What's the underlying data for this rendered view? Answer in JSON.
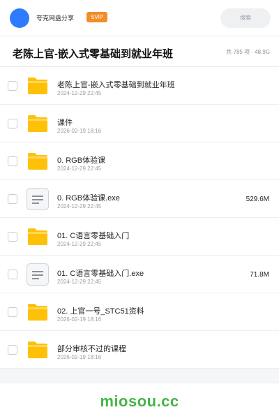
{
  "header": {
    "site_name": "夸克网盘分享",
    "badge": "SVIP",
    "search_placeholder": "搜索",
    "accent_color": "#2f7bff",
    "badge_color": "#f28c28"
  },
  "share": {
    "title": "老陈上官-嵌入式零基础到就业年班",
    "summary": "共 785 项 · 48.9G"
  },
  "items": [
    {
      "type": "folder-icon",
      "name": "老陈上官-嵌入式零基础到就业年班",
      "date": "2024-12-29 22:45",
      "size": ""
    },
    {
      "type": "folder-icon",
      "name": "课件",
      "date": "2026-02-19 18:16",
      "size": ""
    },
    {
      "type": "folder-icon",
      "name": "0. RGB体验课",
      "date": "2024-12-29 22:45",
      "size": ""
    },
    {
      "type": "file-icon",
      "name": "0. RGB体验课.exe",
      "date": "2024-12-29 22:45",
      "size": "529.6M"
    },
    {
      "type": "folder-icon",
      "name": "01. C语言零基础入门",
      "date": "2024-12-29 22:45",
      "size": ""
    },
    {
      "type": "file-icon",
      "name": "01. C语言零基础入门.exe",
      "date": "2024-12-29 22:45",
      "size": "71.8M"
    },
    {
      "type": "folder-icon",
      "name": "02. 上官一号_STC51资料",
      "date": "2026-02-19 18:16",
      "size": ""
    },
    {
      "type": "folder-icon",
      "name": "部分审核不过的课程",
      "date": "2026-02-19 18:16",
      "size": ""
    }
  ],
  "footer": {
    "watermark": "miosou.cc",
    "watermark_color": "#45b549"
  }
}
